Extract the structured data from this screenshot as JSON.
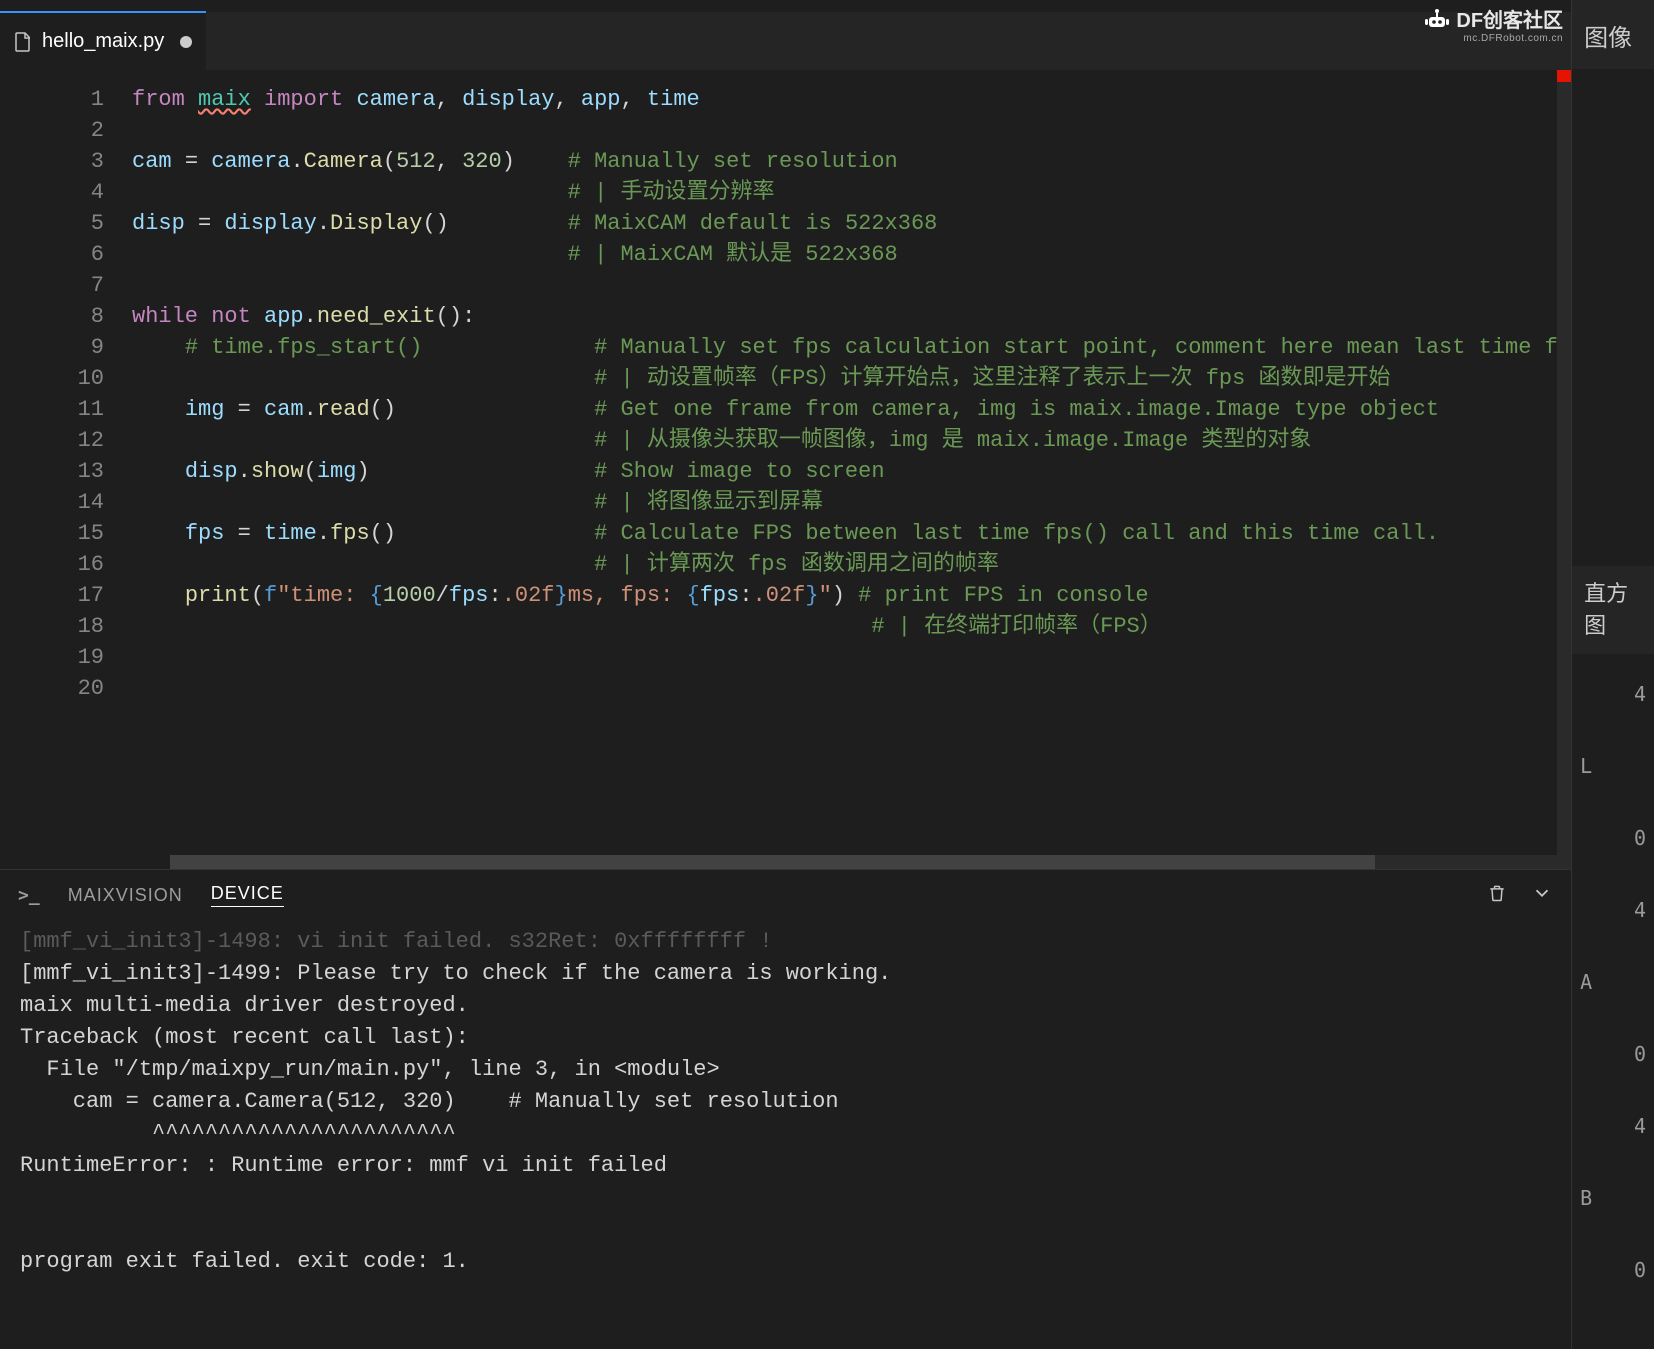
{
  "brand": {
    "title": "DF创客社区",
    "subtitle": "mc.DFRobot.com.cn"
  },
  "tab": {
    "filename": "hello_maix.py"
  },
  "code_lines": [
    {
      "n": 1,
      "html": "<span class='kw'>from</span> <span class='mod sqg'>maix</span> <span class='kw'>import</span> <span class='var'>camera</span><span class='pun'>,</span> <span class='var'>display</span><span class='pun'>,</span> <span class='var'>app</span><span class='pun'>,</span> <span class='var'>time</span>"
    },
    {
      "n": 2,
      "html": ""
    },
    {
      "n": 3,
      "html": "<span class='var'>cam</span> <span class='pun'>=</span> <span class='var'>camera</span><span class='pun'>.</span><span class='fn'>Camera</span><span class='pun'>(</span><span class='num'>512</span><span class='pun'>,</span> <span class='num'>320</span><span class='pun'>)</span>    <span class='cmt'># Manually set resolution</span>"
    },
    {
      "n": 4,
      "html": "                                 <span class='cmt'># | 手动设置分辨率</span>"
    },
    {
      "n": 5,
      "html": "<span class='var'>disp</span> <span class='pun'>=</span> <span class='var'>display</span><span class='pun'>.</span><span class='fn'>Display</span><span class='pun'>()</span>         <span class='cmt'># MaixCAM default is 522x368</span>"
    },
    {
      "n": 6,
      "html": "                                 <span class='cmt'># | MaixCAM 默认是 522x368</span>"
    },
    {
      "n": 7,
      "html": ""
    },
    {
      "n": 8,
      "html": "<span class='kw'>while</span> <span class='kw'>not</span> <span class='var'>app</span><span class='pun'>.</span><span class='fn'>need_exit</span><span class='pun'>():</span>"
    },
    {
      "n": 9,
      "html": "<span class='guide'>    </span><span class='cmt'># time.fps_start()</span>             <span class='cmt'># Manually set fps calculation start point, comment here mean last time fp</span>"
    },
    {
      "n": 10,
      "html": "<span class='guide'>    </span>                               <span class='cmt'># | 动设置帧率（FPS）计算开始点，这里注释了表示上一次 fps 函数即是开始</span>"
    },
    {
      "n": 11,
      "html": "<span class='guide'>    </span><span class='var'>img</span> <span class='pun'>=</span> <span class='var'>cam</span><span class='pun'>.</span><span class='fn'>read</span><span class='pun'>()</span>               <span class='cmt'># Get one frame from camera, img is maix.image.Image type object</span>"
    },
    {
      "n": 12,
      "html": "<span class='guide'>    </span>                               <span class='cmt'># | 从摄像头获取一帧图像，img 是 maix.image.Image 类型的对象</span>"
    },
    {
      "n": 13,
      "html": "<span class='guide'>    </span><span class='var'>disp</span><span class='pun'>.</span><span class='fn'>show</span><span class='pun'>(</span><span class='var'>img</span><span class='pun'>)</span>                 <span class='cmt'># Show image to screen</span>"
    },
    {
      "n": 14,
      "html": "<span class='guide'>    </span>                               <span class='cmt'># | 将图像显示到屏幕</span>"
    },
    {
      "n": 15,
      "html": "<span class='guide'>    </span><span class='var'>fps</span> <span class='pun'>=</span> <span class='var'>time</span><span class='pun'>.</span><span class='fn'>fps</span><span class='pun'>()</span>               <span class='cmt'># Calculate FPS between last time fps() call and this time call.</span>"
    },
    {
      "n": 16,
      "html": "<span class='guide'>    </span>                               <span class='cmt'># | 计算两次 fps 函数调用之间的帧率</span>"
    },
    {
      "n": 17,
      "html": "<span class='guide'>    </span><span class='fn'>print</span><span class='pun'>(</span><span class='brc'>f</span><span class='str'>\"time: </span><span class='brc'>{</span><span class='num'>1000</span><span class='pun'>/</span><span class='var'>fps</span><span class='pun'>:</span><span class='str'>.02f</span><span class='brc'>}</span><span class='str'>ms, fps: </span><span class='brc'>{</span><span class='var'>fps</span><span class='pun'>:</span><span class='str'>.02f</span><span class='brc'>}</span><span class='str'>\"</span><span class='pun'>)</span> <span class='cmt'># print FPS in console</span>"
    },
    {
      "n": 18,
      "html": "<span class='guide'>    </span>                                                    <span class='cmt'># | 在终端打印帧率（FPS）</span>"
    },
    {
      "n": 19,
      "html": ""
    },
    {
      "n": 20,
      "html": ""
    }
  ],
  "terminal": {
    "tabs": [
      {
        "label": "MAIXVISION",
        "active": false
      },
      {
        "label": "DEVICE",
        "active": true
      }
    ],
    "output_lines": [
      "[mmf_vi_init3]-1498: vi init failed. s32Ret: 0xffffffff !",
      "[mmf_vi_init3]-1499: Please try to check if the camera is working.",
      "maix multi-media driver destroyed.",
      "Traceback (most recent call last):",
      "  File \"/tmp/maixpy_run/main.py\", line 3, in <module>",
      "    cam = camera.Camera(512, 320)    # Manually set resolution",
      "          ^^^^^^^^^^^^^^^^^^^^^^^",
      "RuntimeError: : Runtime error: mmf vi init failed",
      "",
      "",
      "program exit failed. exit code: 1."
    ]
  },
  "side": {
    "image_label": "图像",
    "hist_label": "直方图",
    "metrics": [
      {
        "label": "L",
        "v0": "4",
        "v1": "0"
      },
      {
        "label": "A",
        "v0": "4",
        "v1": "0"
      },
      {
        "label": "B",
        "v0": "4",
        "v1": "0"
      }
    ]
  }
}
